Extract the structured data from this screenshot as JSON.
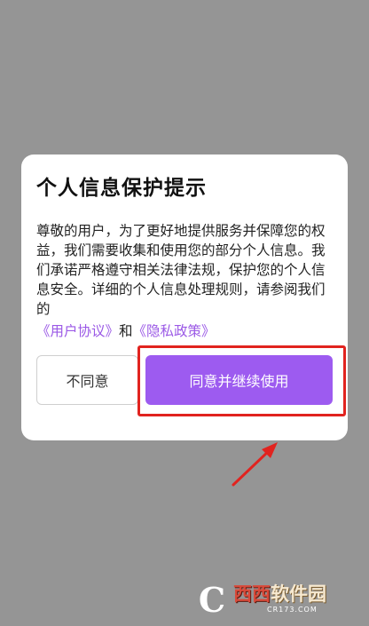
{
  "dialog": {
    "title": "个人信息保护提示",
    "body": "尊敬的用户，为了更好地提供服务并保障您的权益，我们需要收集和使用您的部分个人信息。我们承诺严格遵守相关法律法规，保护您的个人信息安全。详细的个人信息处理规则，请参阅我们的",
    "user_agreement_link": "《用户协议》",
    "and_text": "和",
    "privacy_policy_link": "《隐私政策》",
    "decline_label": "不同意",
    "agree_label": "同意并继续使用"
  },
  "colors": {
    "overlay": "#959595",
    "accent": "#9d5bf0",
    "link": "#9b59e6",
    "highlight": "#e1231f"
  },
  "watermark": {
    "logo_text": "C",
    "brand_red": "西西",
    "brand_rest": "软件园",
    "domain": "CR173.COM"
  }
}
